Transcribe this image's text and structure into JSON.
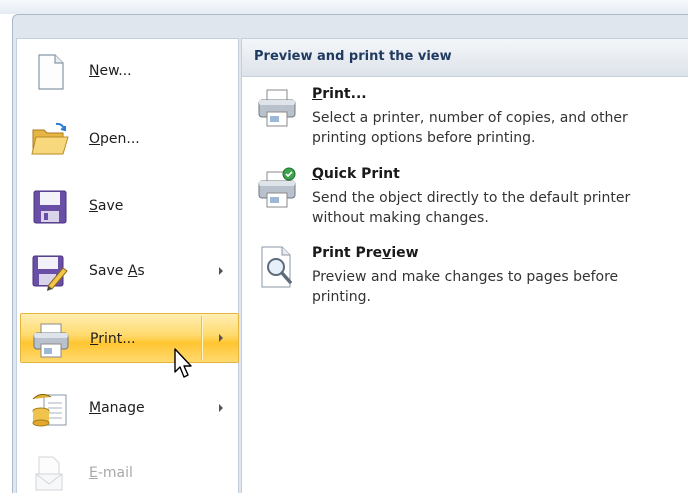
{
  "menu": {
    "items": [
      {
        "name": "new",
        "label_mnemonic": "N",
        "label_rest": "ew...",
        "has_submenu": false,
        "disabled": false
      },
      {
        "name": "open",
        "label_mnemonic": "O",
        "label_rest": "pen...",
        "has_submenu": false,
        "disabled": false
      },
      {
        "name": "save",
        "label_mnemonic": "S",
        "label_rest": "ave",
        "has_submenu": false,
        "disabled": false
      },
      {
        "name": "save-as",
        "label_pre": "Save ",
        "label_mnemonic": "A",
        "label_rest": "s",
        "has_submenu": true,
        "disabled": false
      },
      {
        "name": "print",
        "label_mnemonic": "P",
        "label_rest": "rint...",
        "has_submenu": true,
        "disabled": false,
        "highlighted": true
      },
      {
        "name": "manage",
        "label_mnemonic": "M",
        "label_rest": "anage",
        "has_submenu": true,
        "disabled": false
      },
      {
        "name": "email",
        "label_mnemonic": "E",
        "label_rest": "-mail",
        "has_submenu": false,
        "disabled": true
      }
    ]
  },
  "submenu": {
    "header": "Preview and print the view",
    "items": [
      {
        "name": "print",
        "title_mnemonic": "P",
        "title_rest": "rint...",
        "description": "Select a printer, number of copies, and other printing options before printing."
      },
      {
        "name": "quick-print",
        "title_pre": "",
        "title_mnemonic": "Q",
        "title_rest": "uick Print",
        "description": "Send the object directly to the default printer without making changes."
      },
      {
        "name": "print-preview",
        "title_pre": "Print Pre",
        "title_mnemonic": "v",
        "title_rest": "iew",
        "description": "Preview and make changes to pages before printing."
      }
    ]
  },
  "colors": {
    "highlight": "#ffc531",
    "header_text": "#1f3a5f",
    "frame": "#dfe6ee"
  }
}
